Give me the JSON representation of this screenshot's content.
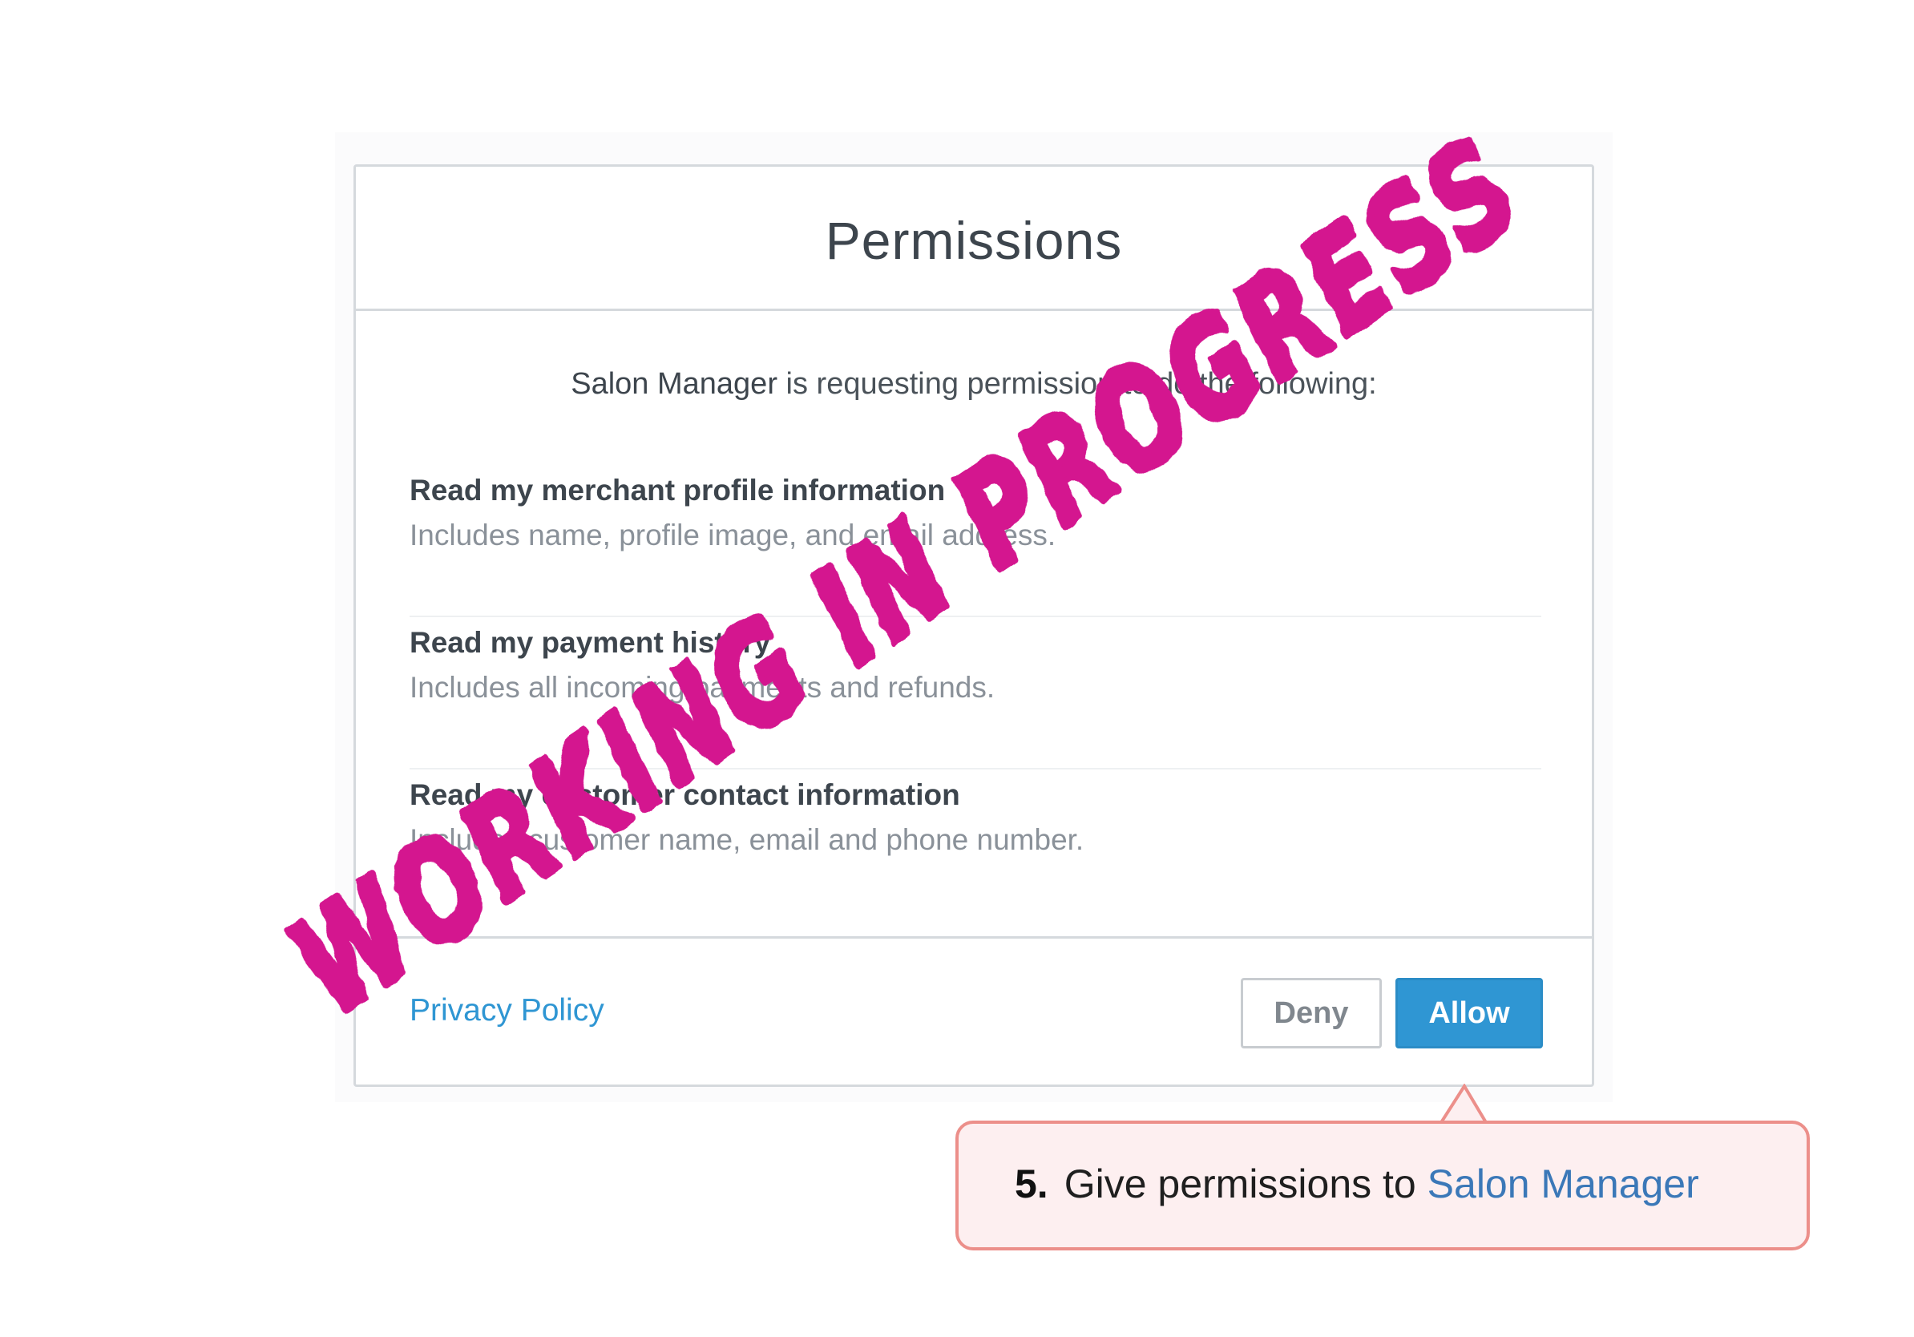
{
  "dialog": {
    "title": "Permissions",
    "request": {
      "app_name": "Salon Manager",
      "text": "is requesting permission to do the following:"
    },
    "permissions": [
      {
        "title": "Read my merchant profile information",
        "description": "Includes name, profile image, and email address."
      },
      {
        "title": "Read my payment history",
        "description": "Includes all incoming payments and refunds."
      },
      {
        "title": "Read my customer contact information",
        "description": "Includes customer name, email and phone number."
      }
    ],
    "footer": {
      "privacy_link": "Privacy Policy",
      "deny_label": "Deny",
      "allow_label": "Allow"
    }
  },
  "callout": {
    "step_number": "5.",
    "text": "Give permissions to",
    "app_name": "Salon Manager"
  },
  "watermark": {
    "text": "WORKING IN PROGRESS",
    "color": "#d4148f"
  },
  "colors": {
    "accent": "#2f96d3",
    "callout_border": "#ec8f8a",
    "callout_bg": "#fdeff0",
    "callout_app": "#3b78b8"
  }
}
